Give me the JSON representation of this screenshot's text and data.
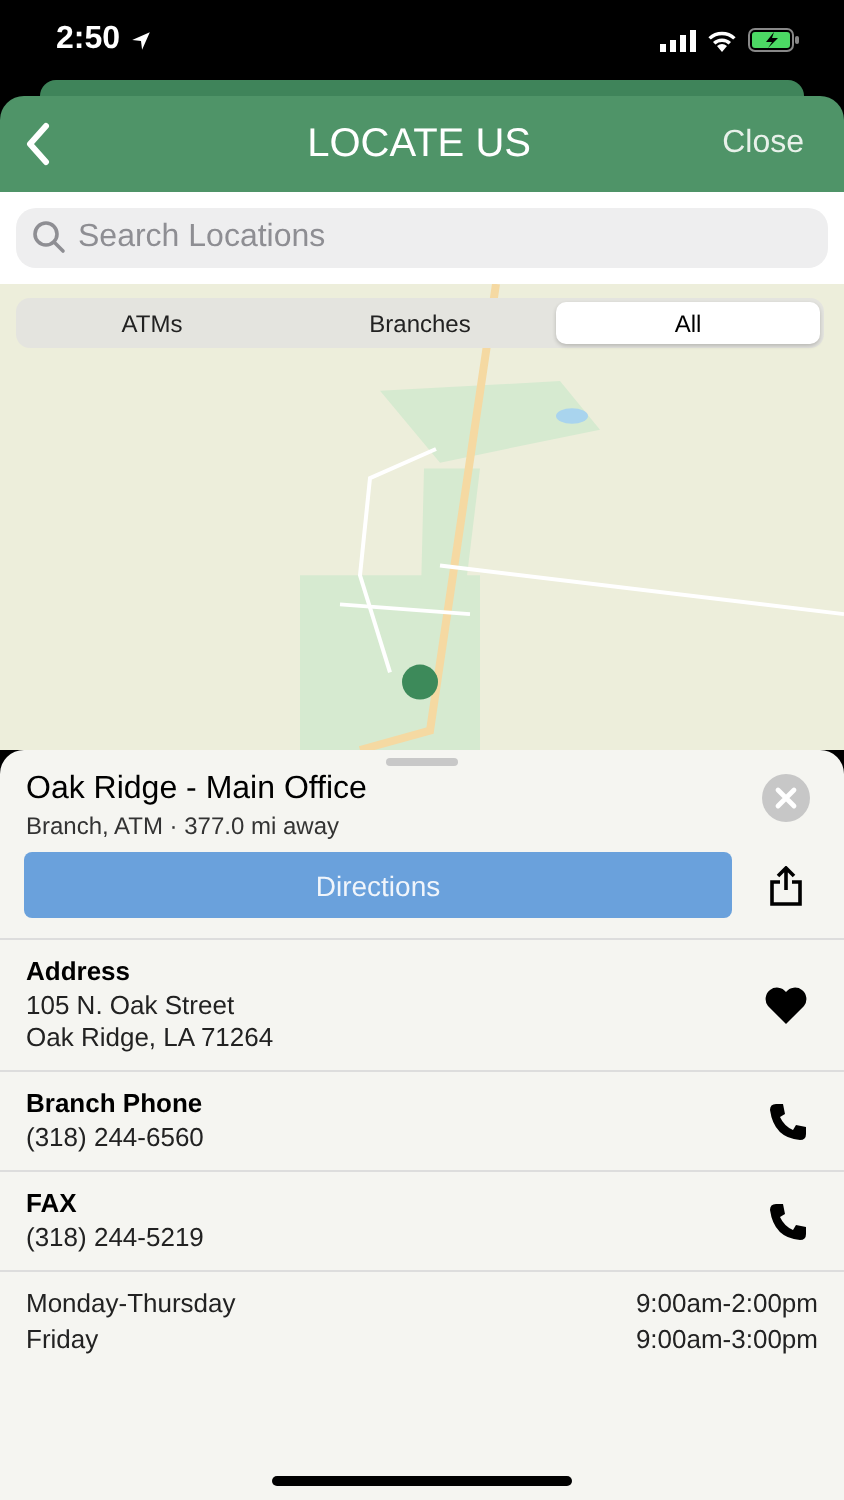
{
  "status_bar": {
    "time": "2:50"
  },
  "header": {
    "title": "LOCATE US",
    "close": "Close"
  },
  "search": {
    "placeholder": "Search Locations"
  },
  "filter_tabs": [
    {
      "label": "ATMs",
      "selected": false
    },
    {
      "label": "Branches",
      "selected": false
    },
    {
      "label": "All",
      "selected": true
    }
  ],
  "location": {
    "name": "Oak Ridge - Main Office",
    "subtitle": "Branch, ATM · 377.0 mi away",
    "directions": "Directions",
    "details": [
      {
        "kind": "address",
        "label": "Address",
        "lines": [
          "105 N. Oak Street",
          "Oak Ridge, LA 71264"
        ]
      },
      {
        "kind": "phone",
        "label": "Branch Phone",
        "lines": [
          "(318) 244-6560"
        ]
      },
      {
        "kind": "phone",
        "label": "FAX",
        "lines": [
          "(318) 244-5219"
        ]
      }
    ],
    "hours": [
      {
        "days": "Monday-Thursday",
        "time": "9:00am-2:00pm"
      },
      {
        "days": "Friday",
        "time": "9:00am-3:00pm"
      }
    ]
  }
}
